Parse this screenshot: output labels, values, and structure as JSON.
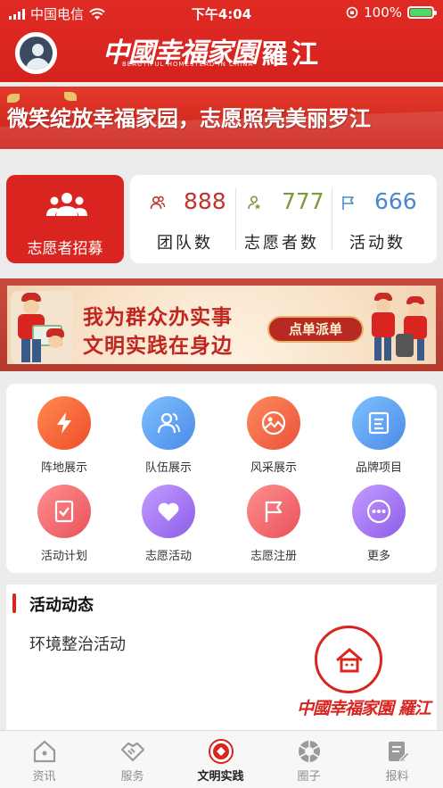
{
  "status_bar": {
    "carrier": "中国电信",
    "time": "下午4:04",
    "battery": "100%"
  },
  "header": {
    "logo_text": "中國幸福家園",
    "city": "羅江",
    "logo_en": "BEAUTIFUL HOMESTEAD IN CHINA"
  },
  "banner": {
    "text": "微笑绽放幸福家园，志愿照亮美丽罗江"
  },
  "recruit": {
    "label": "志愿者招募",
    "icon": "people-group-icon"
  },
  "stats": [
    {
      "value": "888",
      "label": "团队数",
      "color": "#c3322c",
      "icon": "team-icon"
    },
    {
      "value": "777",
      "label": "志愿者数",
      "color": "#7a9a3c",
      "icon": "volunteer-icon"
    },
    {
      "value": "666",
      "label": "活动数",
      "color": "#4a8ac9",
      "icon": "flag-icon"
    }
  ],
  "promo": {
    "line1": "我为群众办实事",
    "line2": "文明实践在身边",
    "button": "点单派单"
  },
  "grid": [
    {
      "label": "阵地展示",
      "icon": "lightning-icon"
    },
    {
      "label": "队伍展示",
      "icon": "team-icon"
    },
    {
      "label": "风采展示",
      "icon": "image-icon"
    },
    {
      "label": "品牌项目",
      "icon": "document-icon"
    },
    {
      "label": "活动计划",
      "icon": "checklist-icon"
    },
    {
      "label": "志愿活动",
      "icon": "heart-icon"
    },
    {
      "label": "志愿注册",
      "icon": "flag-icon"
    },
    {
      "label": "更多",
      "icon": "more-icon"
    }
  ],
  "activity": {
    "title": "活动动态",
    "items": [
      "环境整治活动"
    ],
    "logo_text": "中國幸福家園 羅江"
  },
  "tabs": [
    {
      "label": "资讯",
      "icon": "home-icon",
      "active": false
    },
    {
      "label": "服务",
      "icon": "handshake-icon",
      "active": false
    },
    {
      "label": "文明实践",
      "icon": "emblem-icon",
      "active": true
    },
    {
      "label": "圈子",
      "icon": "aperture-icon",
      "active": false
    },
    {
      "label": "报料",
      "icon": "report-icon",
      "active": false
    }
  ]
}
